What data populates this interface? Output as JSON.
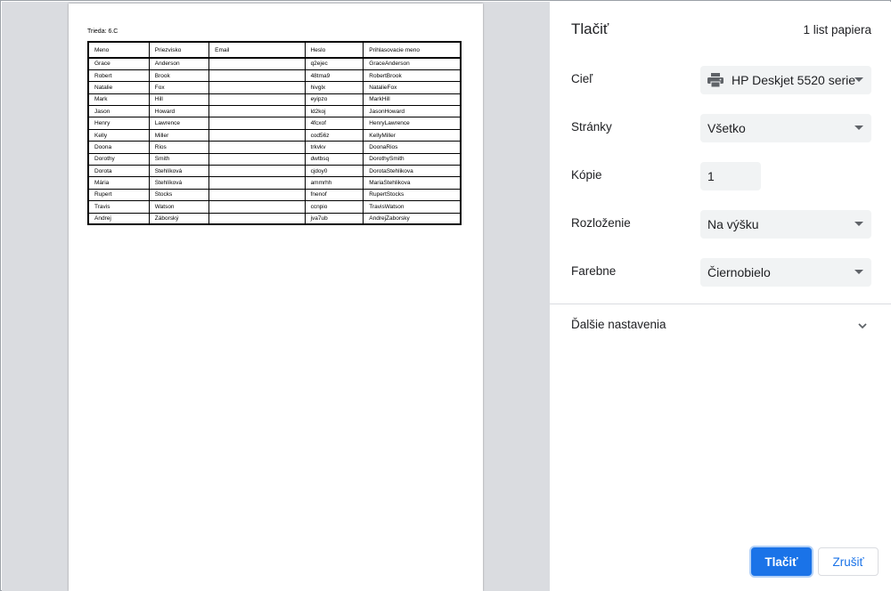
{
  "preview": {
    "header_text": "Trieda: 6.C",
    "columns": [
      "Meno",
      "Priezvisko",
      "Email",
      "Heslo",
      "Prihlasovacie meno"
    ],
    "rows": [
      [
        "Grace",
        "Anderson",
        "",
        "q2ejec",
        "GraceAnderson"
      ],
      [
        "Robert",
        "Brook",
        "",
        "48tma9",
        "RobertBrook"
      ],
      [
        "Natalie",
        "Fox",
        "",
        "hivglx",
        "NatalieFox"
      ],
      [
        "Mark",
        "Hill",
        "",
        "eyipzo",
        "MarkHill"
      ],
      [
        "Jason",
        "Howard",
        "",
        "ld2koj",
        "JasonHoward"
      ],
      [
        "Henry",
        "Lawrence",
        "",
        "4fcxof",
        "HenryLawrence"
      ],
      [
        "Kelly",
        "Miller",
        "",
        "cod56z",
        "KellyMiller"
      ],
      [
        "Doona",
        "Rios",
        "",
        "trkvkv",
        "DoonaRios"
      ],
      [
        "Dorothy",
        "Smith",
        "",
        "dwtbsq",
        "DorothySmith"
      ],
      [
        "Dorota",
        "Stehlíková",
        "",
        "cjdoy0",
        "DorotaStehlikova"
      ],
      [
        "Mária",
        "Stehlíková",
        "",
        "ammrhh",
        "MariaStehlikova"
      ],
      [
        "Rupert",
        "Stocks",
        "",
        "fnenof",
        "RupertStocks"
      ],
      [
        "Travis",
        "Watson",
        "",
        "ccnpio",
        "TravisWatson"
      ],
      [
        "Andrej",
        "Záborský",
        "",
        "jva7ub",
        "AndrejZaborsky"
      ]
    ]
  },
  "panel": {
    "title": "Tlačiť",
    "sheet_count": "1 list papiera",
    "destination": {
      "label": "Cieľ",
      "value": "HP Deskjet 5520 serie",
      "icon": "printer-icon"
    },
    "pages": {
      "label": "Stránky",
      "value": "Všetko"
    },
    "copies": {
      "label": "Kópie",
      "value": "1"
    },
    "layout": {
      "label": "Rozloženie",
      "value": "Na výšku"
    },
    "color": {
      "label": "Farebne",
      "value": "Čiernobielo"
    },
    "more_settings": {
      "label": "Ďalšie nastavenia",
      "icon": "chevron-down-icon"
    },
    "print_button": "Tlačiť",
    "cancel_button": "Zrušiť"
  },
  "colors": {
    "accent": "#1a73e8",
    "preview_background": "#dadce0",
    "field_background": "#f1f3f4"
  }
}
